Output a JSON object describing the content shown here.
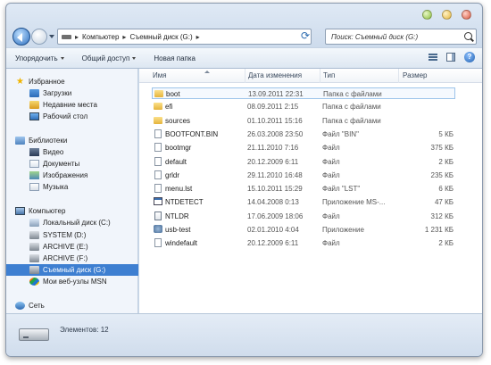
{
  "breadcrumb": [
    "Компьютер",
    "Съемный диск (G:)"
  ],
  "search": {
    "placeholder": "Поиск: Съемный диск (G:)"
  },
  "toolbar": {
    "organize": "Упорядочить",
    "share": "Общий доступ",
    "new_folder": "Новая папка"
  },
  "sidebar": {
    "favorites": {
      "label": "Избранное",
      "items": [
        "Загрузки",
        "Недавние места",
        "Рабочий стол"
      ]
    },
    "libraries": {
      "label": "Библиотеки",
      "items": [
        "Видео",
        "Документы",
        "Изображения",
        "Музыка"
      ]
    },
    "computer": {
      "label": "Компьютер",
      "items": [
        "Локальный диск (C:)",
        "SYSTEM (D:)",
        "ARCHIVE (E:)",
        "ARCHIVE (F:)",
        "Съемный диск (G:)",
        "Мои веб-узлы MSN"
      ]
    },
    "network": {
      "label": "Сеть"
    }
  },
  "columns": {
    "name": "Имя",
    "date": "Дата изменения",
    "type": "Тип",
    "size": "Размер"
  },
  "files": [
    {
      "name": "boot",
      "date": "13.09.2011 22:31",
      "type": "Папка с файлами",
      "size": "",
      "icon": "folder"
    },
    {
      "name": "efi",
      "date": "08.09.2011 2:15",
      "type": "Папка с файлами",
      "size": "",
      "icon": "folder"
    },
    {
      "name": "sources",
      "date": "01.10.2011 15:16",
      "type": "Папка с файлами",
      "size": "",
      "icon": "folder"
    },
    {
      "name": "BOOTFONT.BIN",
      "date": "26.03.2008 23:50",
      "type": "Файл \"BIN\"",
      "size": "5 КБ",
      "icon": "file"
    },
    {
      "name": "bootmgr",
      "date": "21.11.2010 7:16",
      "type": "Файл",
      "size": "375 КБ",
      "icon": "file"
    },
    {
      "name": "default",
      "date": "20.12.2009 6:11",
      "type": "Файл",
      "size": "2 КБ",
      "icon": "file"
    },
    {
      "name": "grldr",
      "date": "29.11.2010 16:48",
      "type": "Файл",
      "size": "235 КБ",
      "icon": "file"
    },
    {
      "name": "menu.lst",
      "date": "15.10.2011 15:29",
      "type": "Файл \"LST\"",
      "size": "6 КБ",
      "icon": "file"
    },
    {
      "name": "NTDETECT",
      "date": "14.04.2008 0:13",
      "type": "Приложение MS-...",
      "size": "47 КБ",
      "icon": "app"
    },
    {
      "name": "NTLDR",
      "date": "17.06.2009 18:06",
      "type": "Файл",
      "size": "312 КБ",
      "icon": "sys"
    },
    {
      "name": "usb-test",
      "date": "02.01.2010 4:04",
      "type": "Приложение",
      "size": "1 231 КБ",
      "icon": "usb"
    },
    {
      "name": "windefault",
      "date": "20.12.2009 6:11",
      "type": "Файл",
      "size": "2 КБ",
      "icon": "file"
    }
  ],
  "status": {
    "count": "Элементов: 12"
  },
  "colors": {
    "selection": "#3e7fd1",
    "sidebar_bg": "#f1f5fb",
    "toolbar_bg": "#dde7f2"
  }
}
